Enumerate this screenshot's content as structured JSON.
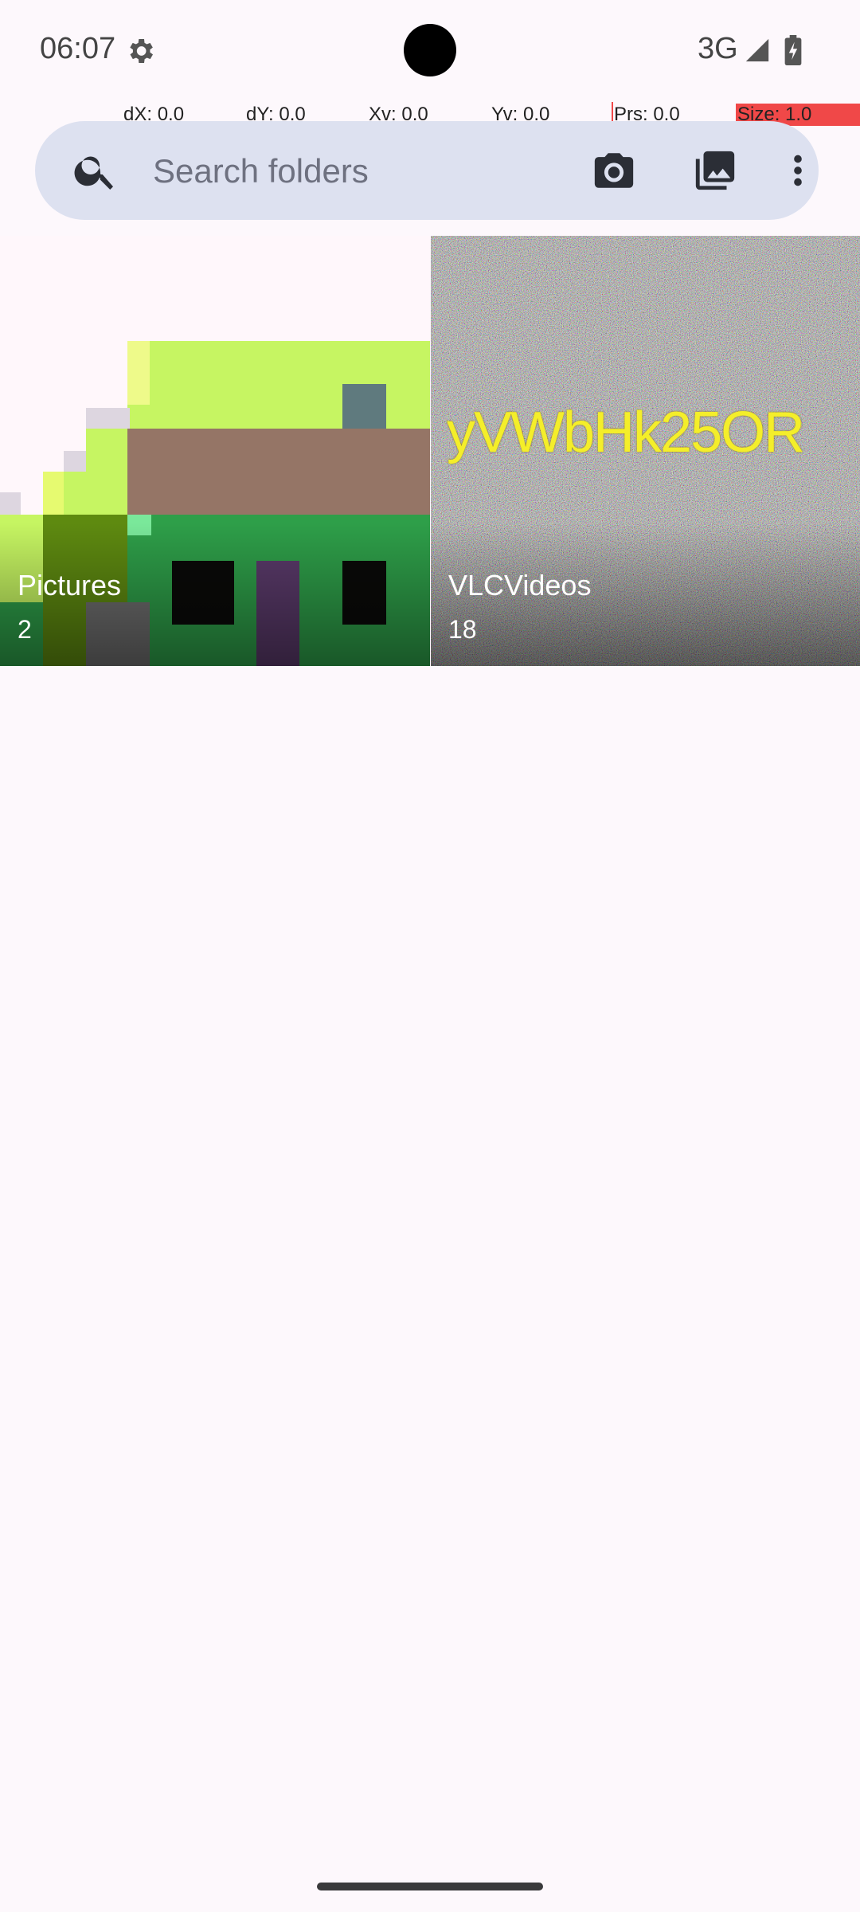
{
  "status_bar": {
    "time": "06:07",
    "network": "3G",
    "icons": [
      "settings-gear-icon",
      "signal-icon",
      "battery-charging-icon"
    ]
  },
  "pointer_overlay": {
    "dx": "dX: 0.0",
    "dy": "dY: 0.0",
    "xv": "Xv: 0.0",
    "yv": "Yv: 0.0",
    "prs": "Prs: 0.0",
    "size": "Size: 1.0"
  },
  "search": {
    "placeholder": "Search folders",
    "actions": [
      "camera-icon",
      "gallery-icon",
      "more-vert-icon"
    ]
  },
  "folders": [
    {
      "name": "Pictures",
      "count": "2"
    },
    {
      "name": "VLCVideos",
      "count": "18",
      "thumbnail_text": "yVWbHk25OR"
    }
  ],
  "colors": {
    "background": "#FDF8FC",
    "search_bar": "#DDE1F0",
    "overlay_red": "#F04848"
  }
}
